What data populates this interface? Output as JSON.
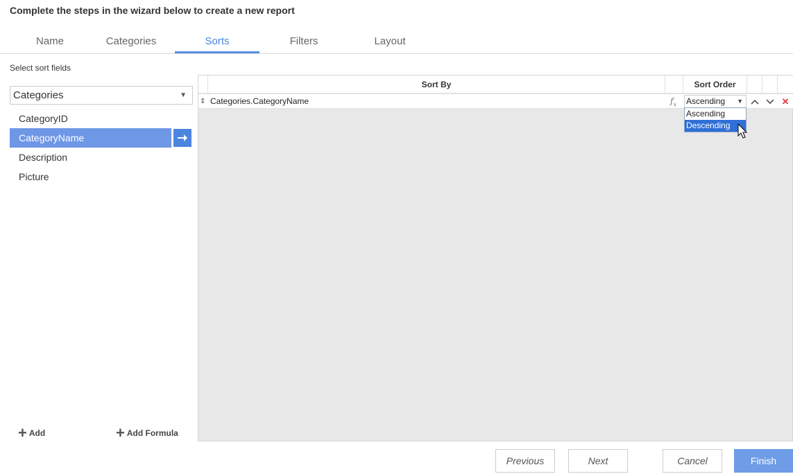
{
  "wizard": {
    "title": "Complete the steps in the wizard below to create a new report"
  },
  "tabs": [
    {
      "label": "Name",
      "active": false
    },
    {
      "label": "Categories",
      "active": false
    },
    {
      "label": "Sorts",
      "active": true
    },
    {
      "label": "Filters",
      "active": false
    },
    {
      "label": "Layout",
      "active": false
    }
  ],
  "left_panel": {
    "label": "Select sort fields",
    "table_select": {
      "value": "Categories"
    },
    "fields": [
      {
        "label": "CategoryID",
        "selected": false
      },
      {
        "label": "CategoryName",
        "selected": true
      },
      {
        "label": "Description",
        "selected": false
      },
      {
        "label": "Picture",
        "selected": false
      }
    ],
    "add_label": "Add",
    "add_formula_label": "Add Formula"
  },
  "grid": {
    "headers": {
      "sort_by": "Sort By",
      "sort_order": "Sort Order"
    },
    "rows": [
      {
        "field": "Categories.CategoryName",
        "fx": "fx",
        "order": "Ascending"
      }
    ],
    "order_options": [
      "Ascending",
      "Descending"
    ],
    "highlighted_option": "Descending"
  },
  "footer": {
    "previous": "Previous",
    "next": "Next",
    "cancel": "Cancel",
    "finish": "Finish"
  },
  "colors": {
    "accent": "#5a8fe0",
    "selected_row": "#6e97e6",
    "finish": "#6e9ce6",
    "delete": "#e23b3b"
  }
}
